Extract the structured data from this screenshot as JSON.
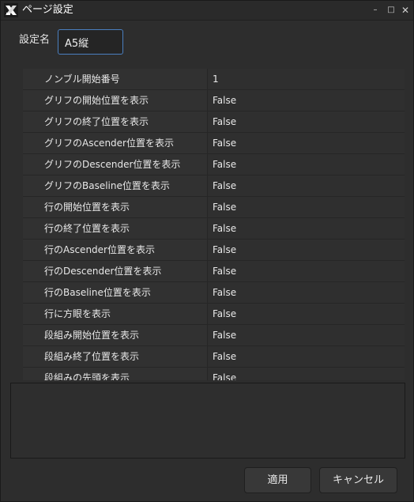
{
  "window": {
    "title": "ページ設定",
    "minimize_glyph": "–",
    "maximize_glyph": "□",
    "close_glyph": "✕",
    "icon": "app-logo-icon"
  },
  "name_field": {
    "label": "設定名",
    "value": "A5縦"
  },
  "properties": [
    {
      "key": "ノンブル開始番号",
      "value": "1"
    },
    {
      "key": "グリフの開始位置を表示",
      "value": "False"
    },
    {
      "key": "グリフの終了位置を表示",
      "value": "False"
    },
    {
      "key": "グリフのAscender位置を表示",
      "value": "False"
    },
    {
      "key": "グリフのDescender位置を表示",
      "value": "False"
    },
    {
      "key": "グリフのBaseline位置を表示",
      "value": "False"
    },
    {
      "key": "行の開始位置を表示",
      "value": "False"
    },
    {
      "key": "行の終了位置を表示",
      "value": "False"
    },
    {
      "key": "行のAscender位置を表示",
      "value": "False"
    },
    {
      "key": "行のDescender位置を表示",
      "value": "False"
    },
    {
      "key": "行のBaseline位置を表示",
      "value": "False"
    },
    {
      "key": "行に方眼を表示",
      "value": "False"
    },
    {
      "key": "段組み開始位置を表示",
      "value": "False"
    },
    {
      "key": "段組み終了位置を表示",
      "value": "False"
    },
    {
      "key": "段組みの先頭を表示",
      "value": "False"
    }
  ],
  "buttons": {
    "apply": "適用",
    "cancel": "キャンセル"
  },
  "colors": {
    "background": "#2d2d2d",
    "focus_border": "#4a7fc0",
    "text": "#e8e8e8"
  }
}
